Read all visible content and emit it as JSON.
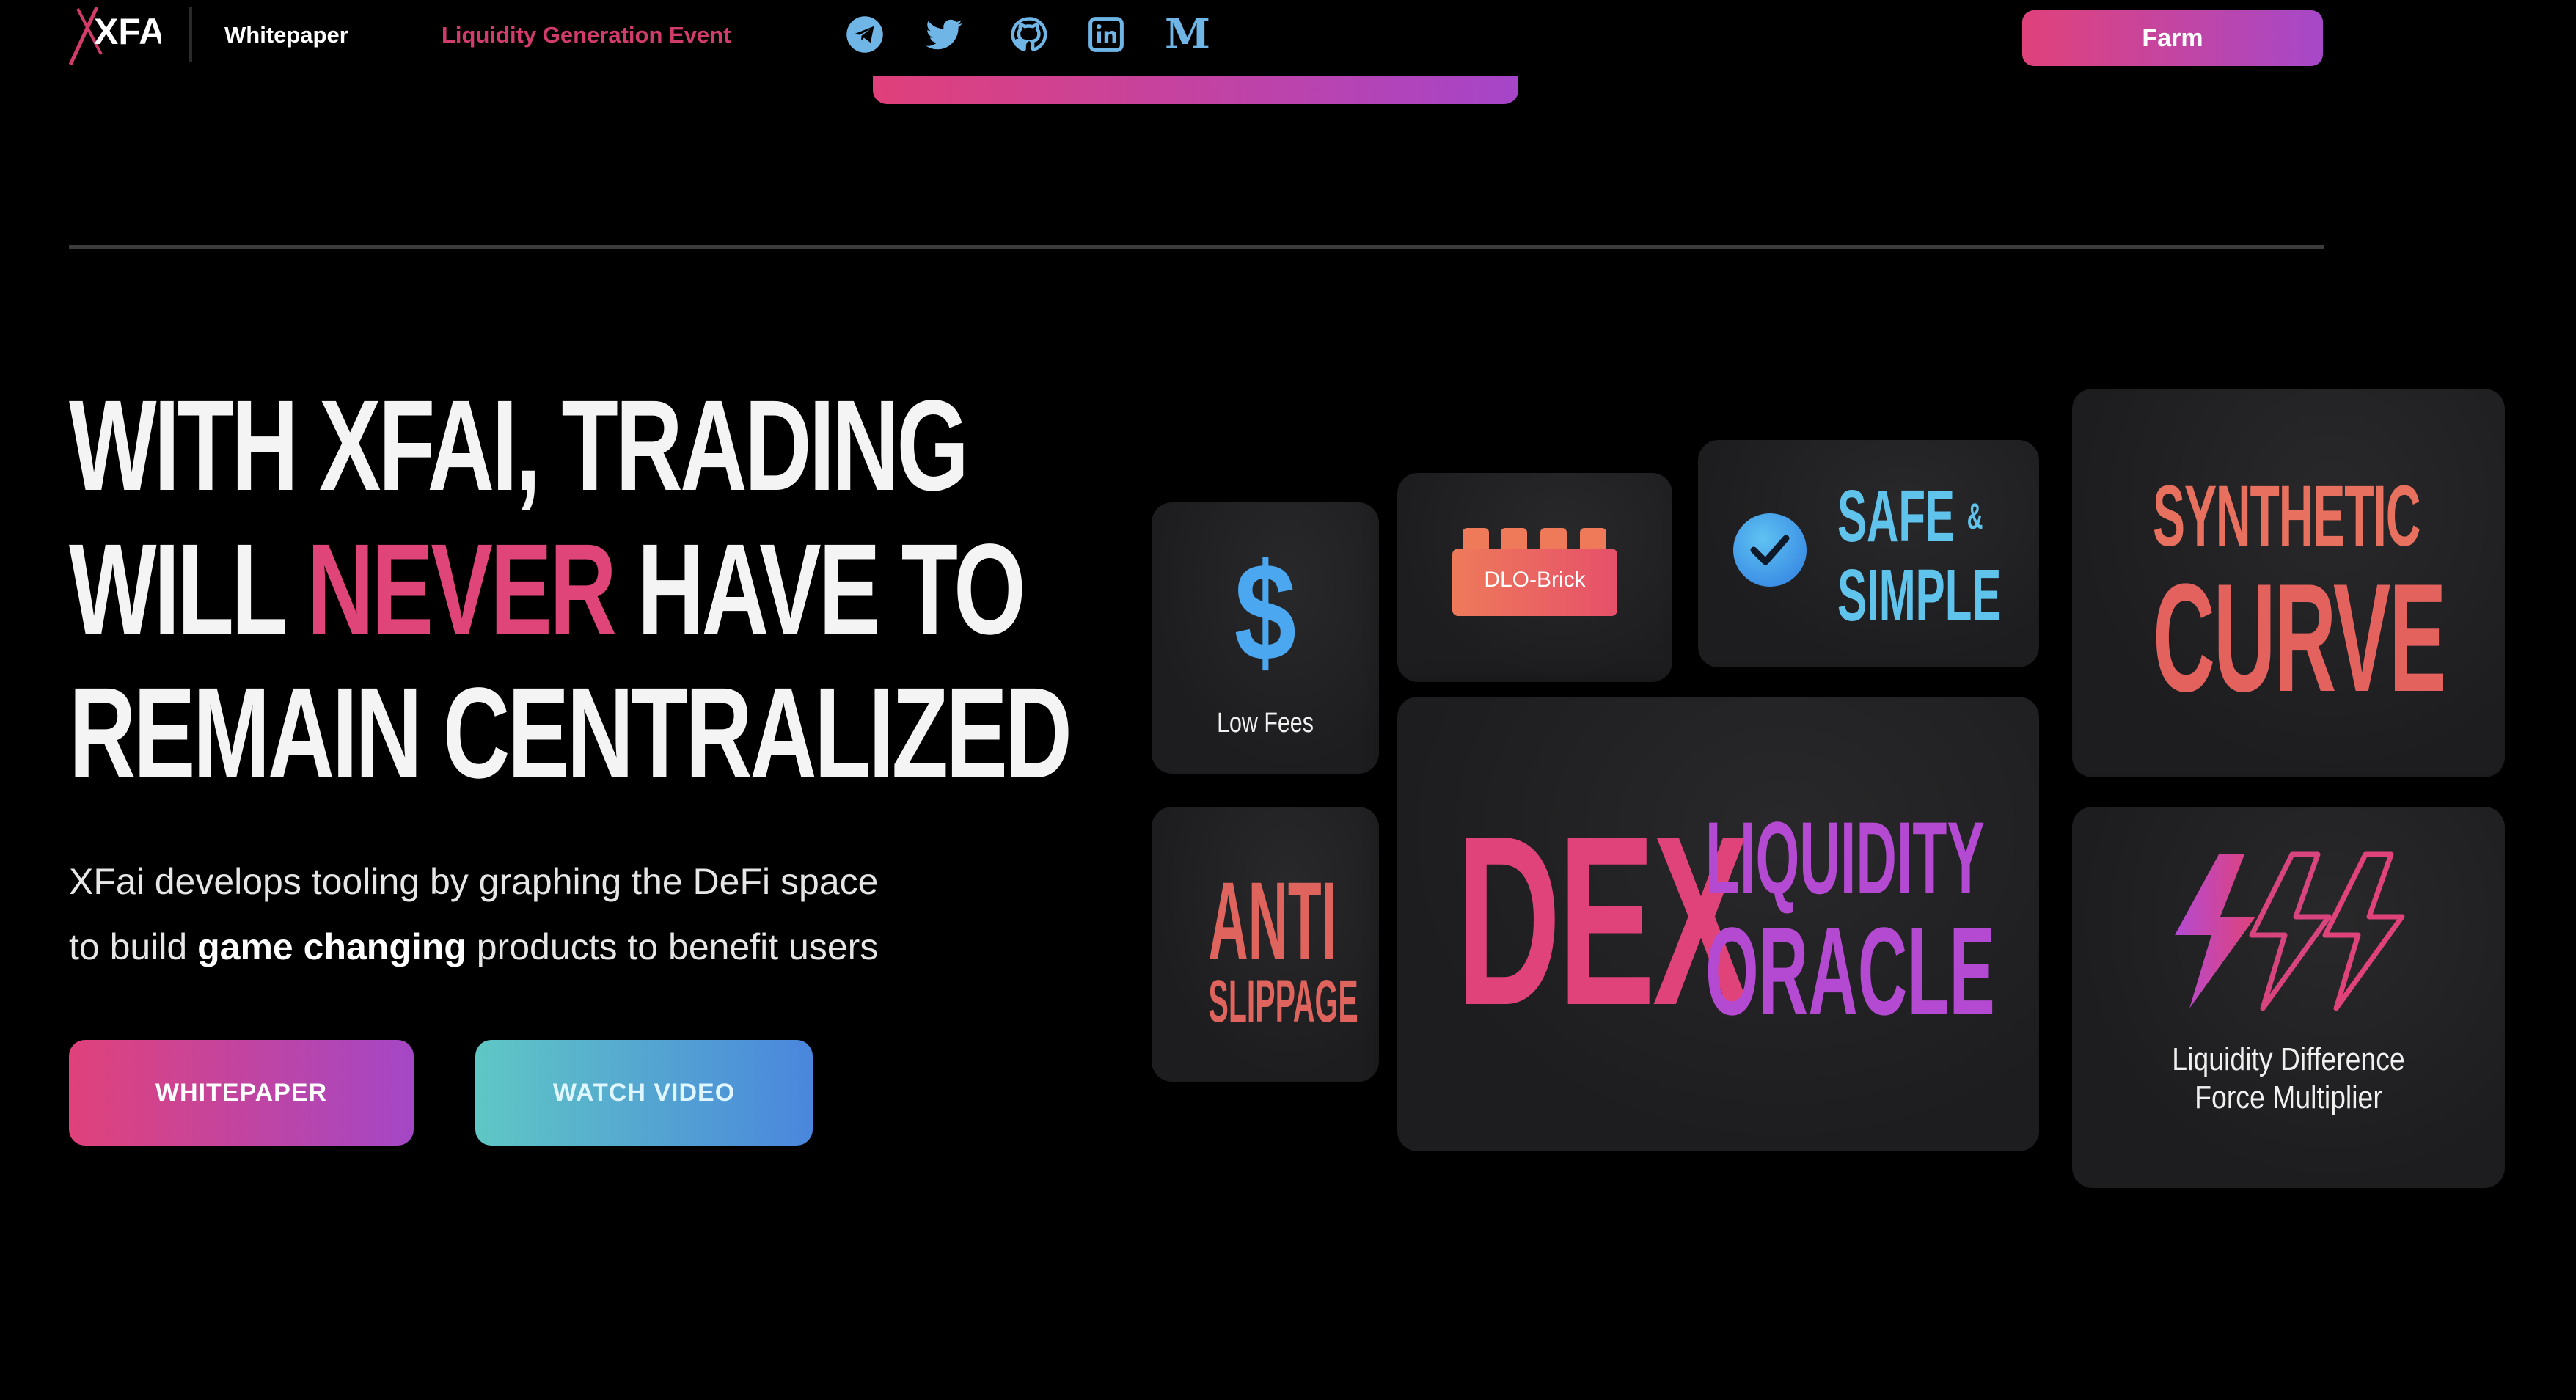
{
  "nav": {
    "logo_text": "XFAI",
    "whitepaper_link": "Whitepaper",
    "lge_link": "Liquidity Generation Event",
    "social_icons": [
      "telegram-icon",
      "twitter-icon",
      "github-icon",
      "linkedin-icon",
      "medium-icon"
    ],
    "medium_glyph": "M",
    "farm_button": "Farm"
  },
  "hero": {
    "headline_line1": "WITH XFAI, TRADING",
    "headline_line2_pre": "WILL ",
    "headline_line2_accent": "NEVER",
    "headline_line2_post": " HAVE TO",
    "headline_line3": "REMAIN CENTRALIZED",
    "sub_line1": "XFai develops tooling by graphing the DeFi space",
    "sub_line2_pre": "to build ",
    "sub_line2_bold": "game changing",
    "sub_line2_post": " products to benefit users",
    "btn_whitepaper": "WHITEPAPER",
    "btn_video": "WATCH VIDEO"
  },
  "cards": {
    "fees_symbol": "$",
    "fees_label": "Low Fees",
    "brick_label": "DLO-Brick",
    "safe_line1": "SAFE",
    "safe_amp": "&",
    "safe_line2": "SIMPLE",
    "synth_line1": "SYNTHETIC",
    "synth_line2": "CURVE",
    "anti_line1": "ANTI",
    "anti_line2": "SLIPPAGE",
    "dex_word": "DEX",
    "dex_line1": "LIQUIDITY",
    "dex_line2": "ORACLE",
    "ldfm_line1": "Liquidity Difference",
    "ldfm_line2": "Force Multiplier"
  },
  "colors": {
    "accent_pink": "#e0427a",
    "accent_purple": "#a648c9",
    "social_blue": "#6fb6e6",
    "video_gradient_start": "#5fc7c4",
    "video_gradient_end": "#4a86dd"
  }
}
